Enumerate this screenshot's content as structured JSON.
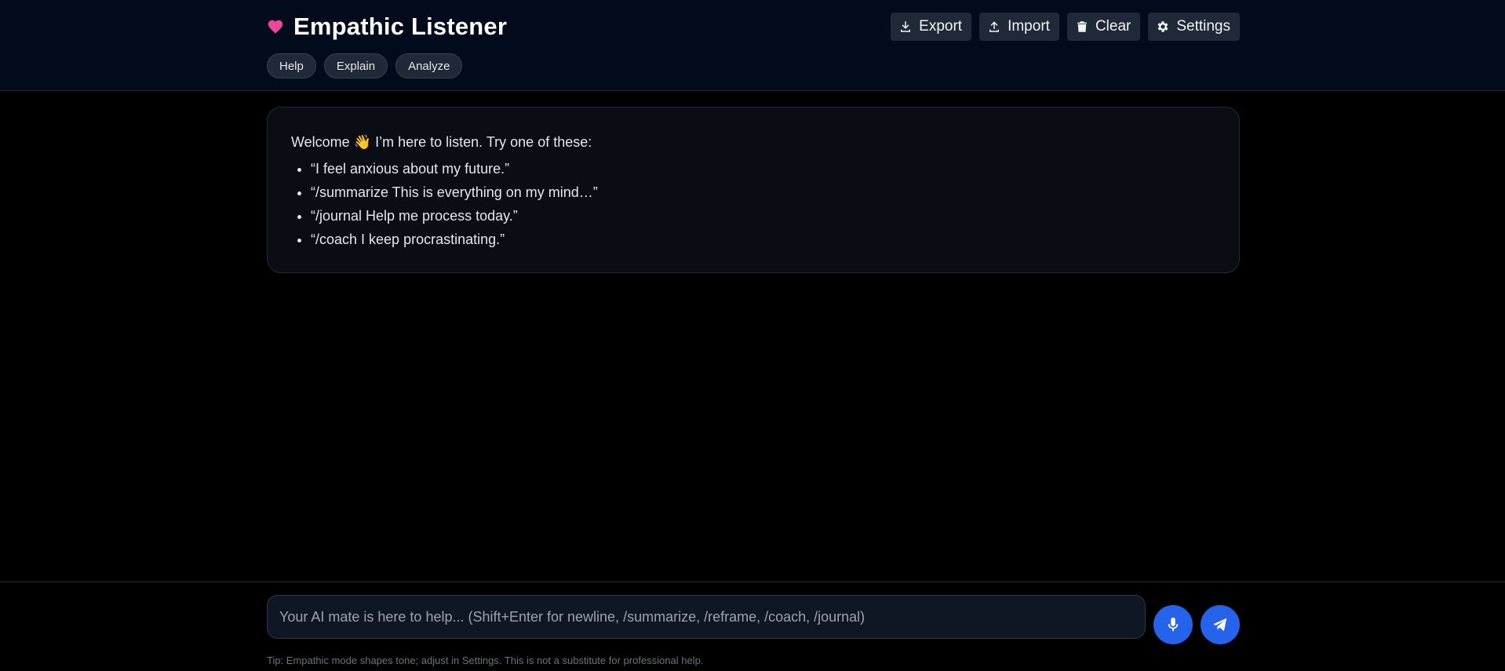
{
  "header": {
    "title": "Empathic Listener",
    "toolbar": {
      "export_label": "Export",
      "import_label": "Import",
      "clear_label": "Clear",
      "settings_label": "Settings"
    },
    "chips": {
      "help": "Help",
      "explain": "Explain",
      "analyze": "Analyze"
    }
  },
  "welcome": {
    "intro": "Welcome 👋 I’m here to listen. Try one of these:",
    "suggestions": [
      "“I feel anxious about my future.”",
      "“/summarize This is everything on my mind…”",
      "“/journal Help me process today.”",
      "“/coach I keep procrastinating.”"
    ]
  },
  "composer": {
    "placeholder": "Your AI mate is here to help... (Shift+Enter for newline, /summarize, /reframe, /coach, /journal)",
    "tip": "Tip: Empathic mode shapes tone; adjust in Settings. This is not a substitute for professional help."
  },
  "icons": {
    "logo": "heart-icon",
    "export": "download-icon",
    "import": "upload-icon",
    "clear": "trash-icon",
    "settings": "gear-icon",
    "mic": "microphone-icon",
    "send": "paper-plane-icon"
  },
  "colors": {
    "accent": "#2563eb",
    "heart": "#ec4899",
    "header_bg": "#020b1c",
    "card_bg": "#0a0d14"
  }
}
